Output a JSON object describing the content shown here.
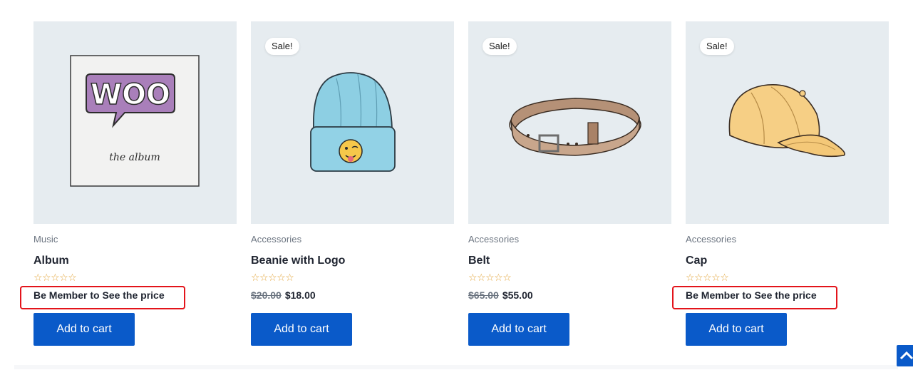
{
  "products": [
    {
      "category": "Music",
      "title": "Album",
      "sale_badge": "",
      "stars": "☆☆☆☆☆",
      "price_old": "",
      "price_current": "Be Member to See the price",
      "highlighted": true,
      "button": "Add to cart",
      "icon": "album-image"
    },
    {
      "category": "Accessories",
      "title": "Beanie with Logo",
      "sale_badge": "Sale!",
      "stars": "☆☆☆☆☆",
      "price_old": "$20.00",
      "price_current": "$18.00",
      "highlighted": false,
      "button": "Add to cart",
      "icon": "beanie-image"
    },
    {
      "category": "Accessories",
      "title": "Belt",
      "sale_badge": "Sale!",
      "stars": "☆☆☆☆☆",
      "price_old": "$65.00",
      "price_current": "$55.00",
      "highlighted": false,
      "button": "Add to cart",
      "icon": "belt-image"
    },
    {
      "category": "Accessories",
      "title": "Cap",
      "sale_badge": "Sale!",
      "stars": "☆☆☆☆☆",
      "price_old": "",
      "price_current": "Be Member to See the price",
      "highlighted": true,
      "button": "Add to cart",
      "icon": "cap-image"
    }
  ],
  "album_art": {
    "logo_text": "WOO",
    "sub_text": "the album"
  },
  "colors": {
    "accent": "#0a5ac9",
    "highlight": "#e3141b",
    "star": "#e2a43a",
    "thumb_bg": "#e6ecf0"
  },
  "scroll_top_icon": "chevron-up-icon"
}
